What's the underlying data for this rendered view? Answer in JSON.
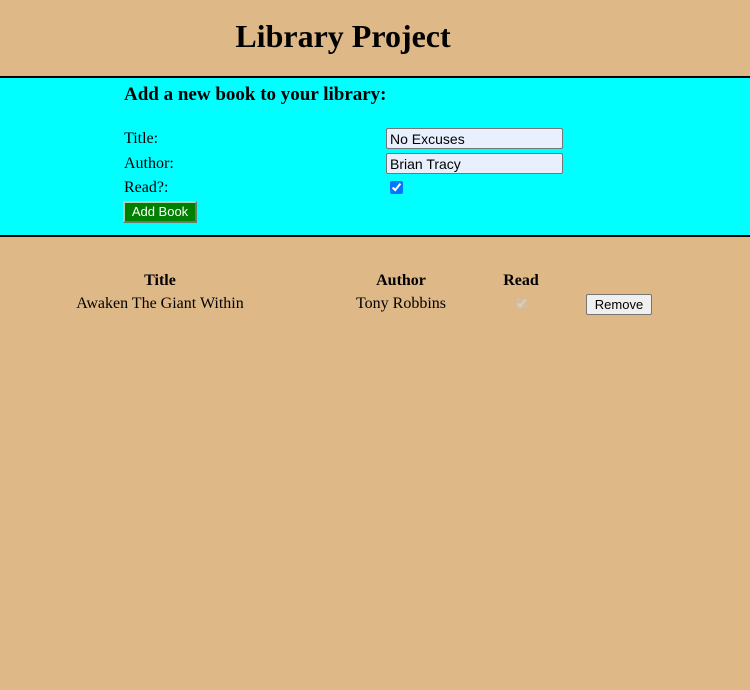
{
  "header": {
    "title": "Library Project"
  },
  "form": {
    "heading": "Add a new book to your library:",
    "title_label": "Title:",
    "title_value": "No Excuses",
    "author_label": "Author:",
    "author_value": "Brian Tracy",
    "read_label": "Read?:",
    "read_checked": true,
    "submit_label": "Add Book"
  },
  "library": {
    "columns": [
      "Title",
      "Author",
      "Read"
    ],
    "rows": [
      {
        "title": "Awaken The Giant Within",
        "author": "Tony Robbins",
        "read": true,
        "remove_label": "Remove"
      }
    ]
  },
  "colors": {
    "background": "#deb887",
    "form_panel": "#00ffff",
    "add_button": "#008000"
  }
}
